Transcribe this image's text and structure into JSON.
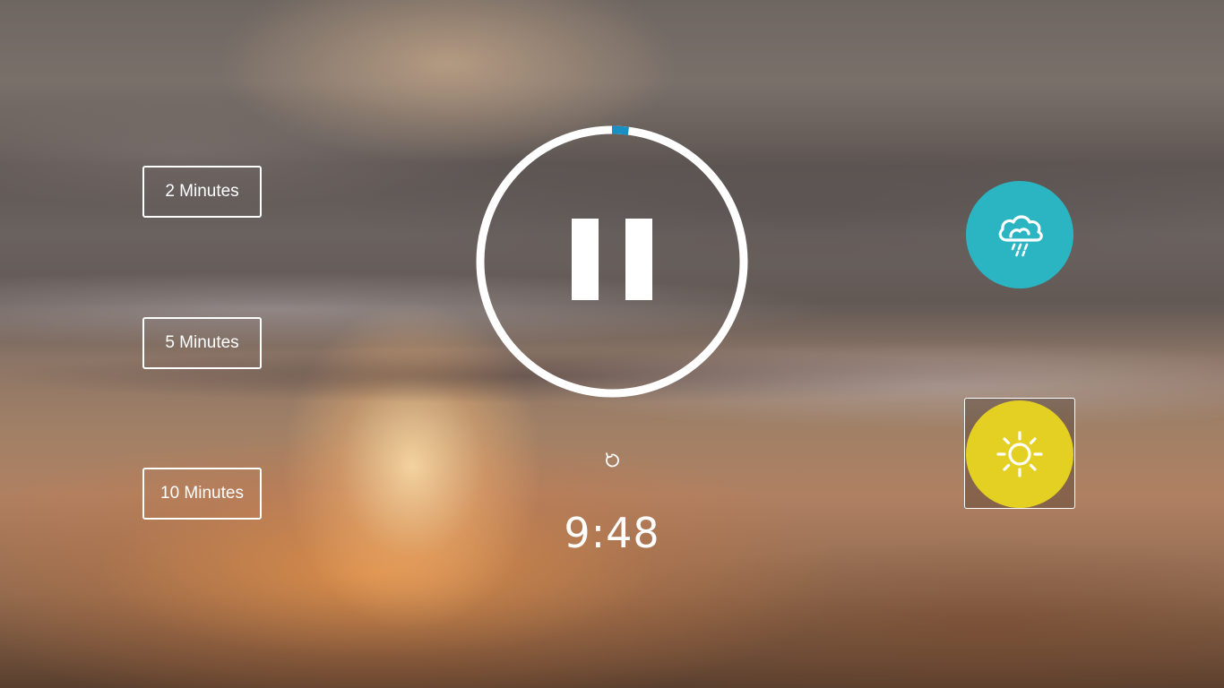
{
  "durations": [
    {
      "label": "2 Minutes"
    },
    {
      "label": "5 Minutes"
    },
    {
      "label": "10 Minutes"
    }
  ],
  "player": {
    "state": "pause-icon",
    "progress_fraction": 0.02,
    "ring_color": "#ffffff",
    "progress_color": "#1a8fc4"
  },
  "timer": {
    "remaining": "9:48"
  },
  "reset": {
    "icon": "reset-icon"
  },
  "sounds": [
    {
      "name": "rain",
      "icon": "cloud-rain-icon",
      "color": "#2bb5c2",
      "selected": false
    },
    {
      "name": "sun",
      "icon": "sun-icon",
      "color": "#e4cf23",
      "selected": true
    }
  ]
}
